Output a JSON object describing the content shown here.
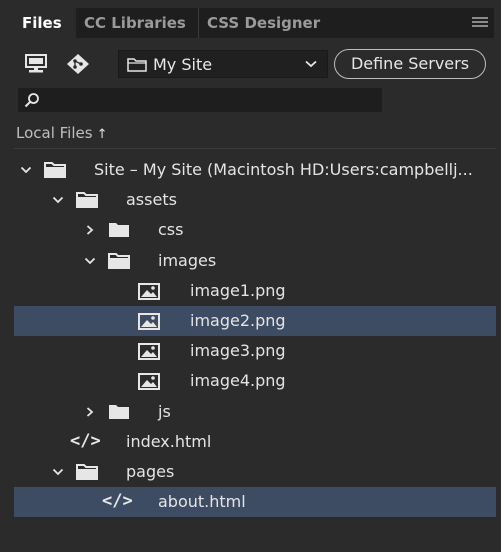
{
  "tabs": [
    {
      "label": "Files",
      "active": true
    },
    {
      "label": "CC Libraries",
      "active": false
    },
    {
      "label": "CSS Designer",
      "active": false
    }
  ],
  "icons": {
    "panel_menu": "hamburger-icon",
    "manage_sites": "monitor-icon",
    "git": "git-icon",
    "search": "search-icon",
    "folder": "folder-icon",
    "image": "image-file-icon",
    "code": "code-file-icon"
  },
  "toolbar": {
    "site_select_value": "My Site",
    "define_servers_label": "Define Servers"
  },
  "search": {
    "placeholder": ""
  },
  "local_files": {
    "label": "Local Files",
    "arrow": "↑"
  },
  "tree": [
    {
      "label": "Site – My Site (Macintosh HD:Users:campbellj...",
      "type": "folder",
      "depth": 0,
      "expanded": true,
      "selected": false
    },
    {
      "label": "assets",
      "type": "folder",
      "depth": 1,
      "expanded": true,
      "selected": false
    },
    {
      "label": "css",
      "type": "folder",
      "depth": 2,
      "expanded": false,
      "selected": false
    },
    {
      "label": "images",
      "type": "folder",
      "depth": 2,
      "expanded": true,
      "selected": false
    },
    {
      "label": "image1.png",
      "type": "image",
      "depth": 3,
      "selected": false
    },
    {
      "label": "image2.png",
      "type": "image",
      "depth": 3,
      "selected": true
    },
    {
      "label": "image3.png",
      "type": "image",
      "depth": 3,
      "selected": false
    },
    {
      "label": "image4.png",
      "type": "image",
      "depth": 3,
      "selected": false
    },
    {
      "label": "js",
      "type": "folder",
      "depth": 2,
      "expanded": false,
      "selected": false
    },
    {
      "label": "index.html",
      "type": "code",
      "depth": 1,
      "selected": false
    },
    {
      "label": "pages",
      "type": "folder",
      "depth": 1,
      "expanded": true,
      "selected": false
    },
    {
      "label": "about.html",
      "type": "code",
      "depth": 2,
      "selected": true
    }
  ],
  "colors": {
    "panel_bg": "#2b2b2b",
    "selection": "#3e4c63",
    "text": "#e4e4e4"
  }
}
